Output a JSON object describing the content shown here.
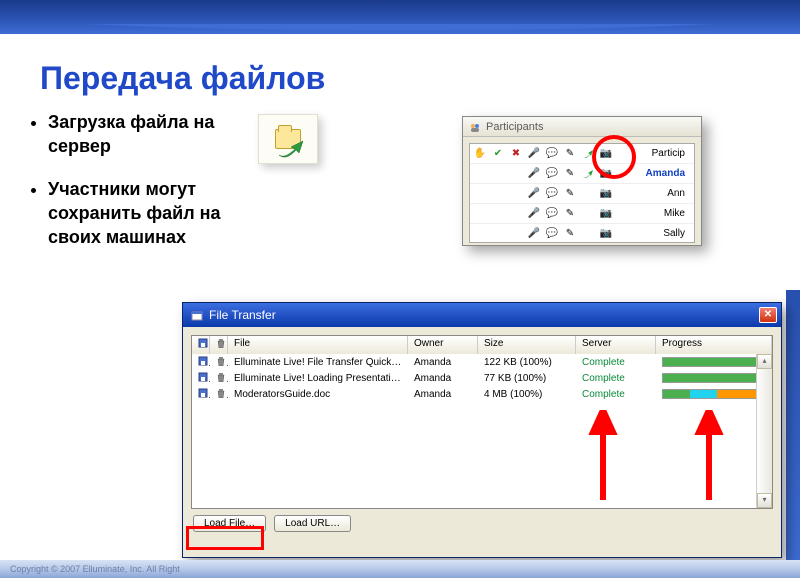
{
  "title": "Передача файлов",
  "bullets": [
    "Загрузка файла на сервер",
    "Участники могут сохранить файл на своих машинах"
  ],
  "participants_panel": {
    "title": "Participants",
    "header_name": "Particip",
    "rows": [
      {
        "name": "Amanda",
        "leader": true
      },
      {
        "name": "Ann",
        "leader": false
      },
      {
        "name": "Mike",
        "leader": false
      },
      {
        "name": "Sally",
        "leader": false
      }
    ]
  },
  "file_transfer": {
    "title": "File Transfer",
    "columns": {
      "file": "File",
      "owner": "Owner",
      "size": "Size",
      "server": "Server",
      "progress": "Progress"
    },
    "rows": [
      {
        "file": "Elluminate Live! File Transfer Quick Re…",
        "owner": "Amanda",
        "size": "122 KB (100%)",
        "server": "Complete",
        "progress": [
          [
            "#4caf50",
            33
          ],
          [
            "#4caf50",
            33
          ],
          [
            "#4caf50",
            34
          ]
        ]
      },
      {
        "file": "Elluminate Live! Loading Presentations…",
        "owner": "Amanda",
        "size": "77 KB (100%)",
        "server": "Complete",
        "progress": [
          [
            "#4caf50",
            33
          ],
          [
            "#4caf50",
            33
          ],
          [
            "#4caf50",
            34
          ]
        ]
      },
      {
        "file": "ModeratorsGuide.doc",
        "owner": "Amanda",
        "size": "4 MB (100%)",
        "server": "Complete",
        "progress": [
          [
            "#4caf50",
            28
          ],
          [
            "#22d3ee",
            28
          ],
          [
            "#ff9800",
            44
          ]
        ]
      }
    ],
    "buttons": {
      "load_file": "Load File…",
      "load_url": "Load URL…"
    }
  },
  "footer": "Copyright © 2007 Elluminate, Inc. All Right"
}
